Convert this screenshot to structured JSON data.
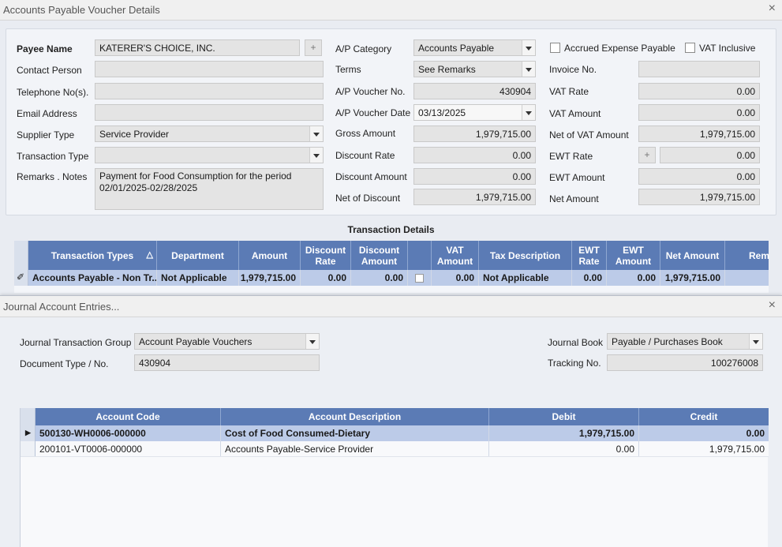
{
  "main_window": {
    "title": "Accounts Payable Voucher Details",
    "close_glyph": "×",
    "payee": {
      "name_label": "Payee Name",
      "name_value": "KATERER'S CHOICE, INC.",
      "contact_label": "Contact Person",
      "contact_value": "",
      "phone_label": "Telephone No(s).",
      "phone_value": "",
      "email_label": "Email Address",
      "email_value": "",
      "supplier_type_label": "Supplier Type",
      "supplier_type_value": "Service Provider",
      "transaction_type_label": "Transaction Type",
      "transaction_type_value": "",
      "remarks_label": "Remarks . Notes",
      "remarks_value": "Payment for Food Consumption for the period 02/01/2025-02/28/2025"
    },
    "middle": {
      "category_label": "A/P Category",
      "category_value": "Accounts Payable",
      "terms_label": "Terms",
      "terms_value": "See Remarks",
      "voucher_no_label": "A/P Voucher No.",
      "voucher_no_value": "430904",
      "voucher_date_label": "A/P Voucher Date",
      "voucher_date_value": "03/13/2025",
      "gross_label": "Gross Amount",
      "gross_value": "1,979,715.00",
      "discount_rate_label": "Discount Rate",
      "discount_rate_value": "0.00",
      "discount_amount_label": "Discount Amount",
      "discount_amount_value": "0.00",
      "net_discount_label": "Net of Discount",
      "net_discount_value": "1,979,715.00"
    },
    "right": {
      "accrued_label": "Accrued Expense Payable",
      "vat_inclusive_label": "VAT Inclusive",
      "invoice_label": "Invoice No.",
      "invoice_value": "",
      "vat_rate_label": "VAT Rate",
      "vat_rate_value": "0.00",
      "vat_amount_label": "VAT Amount",
      "vat_amount_value": "0.00",
      "net_vat_label": "Net of VAT Amount",
      "net_vat_value": "1,979,715.00",
      "ewt_rate_label": "EWT Rate",
      "ewt_rate_value": "0.00",
      "ewt_amount_label": "EWT Amount",
      "ewt_amount_value": "0.00",
      "net_amount_label": "Net Amount",
      "net_amount_value": "1,979,715.00"
    },
    "transaction_details": {
      "title": "Transaction Details",
      "columns": [
        "Transaction Types",
        "Department",
        "Amount",
        "Discount Rate",
        "Discount Amount",
        "",
        "VAT Amount",
        "Tax Description",
        "EWT Rate",
        "EWT Amount",
        "Net Amount",
        "Rem"
      ],
      "sort_glyph": "△",
      "edit_glyph": "✐",
      "row": {
        "transaction_type": "Accounts Payable - Non Tr...",
        "department": "Not Applicable",
        "amount": "1,979,715.00",
        "discount_rate": "0.00",
        "discount_amount": "0.00",
        "vat_amount": "0.00",
        "tax_description": "Not Applicable",
        "ewt_rate": "0.00",
        "ewt_amount": "0.00",
        "net_amount": "1,979,715.00"
      }
    }
  },
  "journal_window": {
    "title": "Journal Account Entries...",
    "close_glyph": "×",
    "group_label": "Journal Transaction Group",
    "group_value": "Account Payable Vouchers",
    "doc_label": "Document Type / No.",
    "doc_value": "430904",
    "book_label": "Journal Book",
    "book_value": "Payable / Purchases Book",
    "tracking_label": "Tracking No.",
    "tracking_value": "100276008",
    "columns": [
      "Account Code",
      "Account Description",
      "Debit",
      "Credit"
    ],
    "rows": [
      {
        "code": "500130-WH0006-000000",
        "description": "Cost of Food Consumed-Dietary",
        "debit": "1,979,715.00",
        "credit": "0.00"
      },
      {
        "code": "200101-VT0006-000000",
        "description": "Accounts Payable-Service Provider",
        "debit": "0.00",
        "credit": "1,979,715.00"
      }
    ],
    "row_pointer_glyph": "▶"
  },
  "icons": {
    "plus": "plus-icon",
    "dropdown": "chevron-down-icon",
    "close": "close-icon"
  },
  "colors": {
    "grid_header": "#5b7bb5",
    "selected_row": "#bccbe8",
    "field_bg": "#e4e4e4"
  }
}
